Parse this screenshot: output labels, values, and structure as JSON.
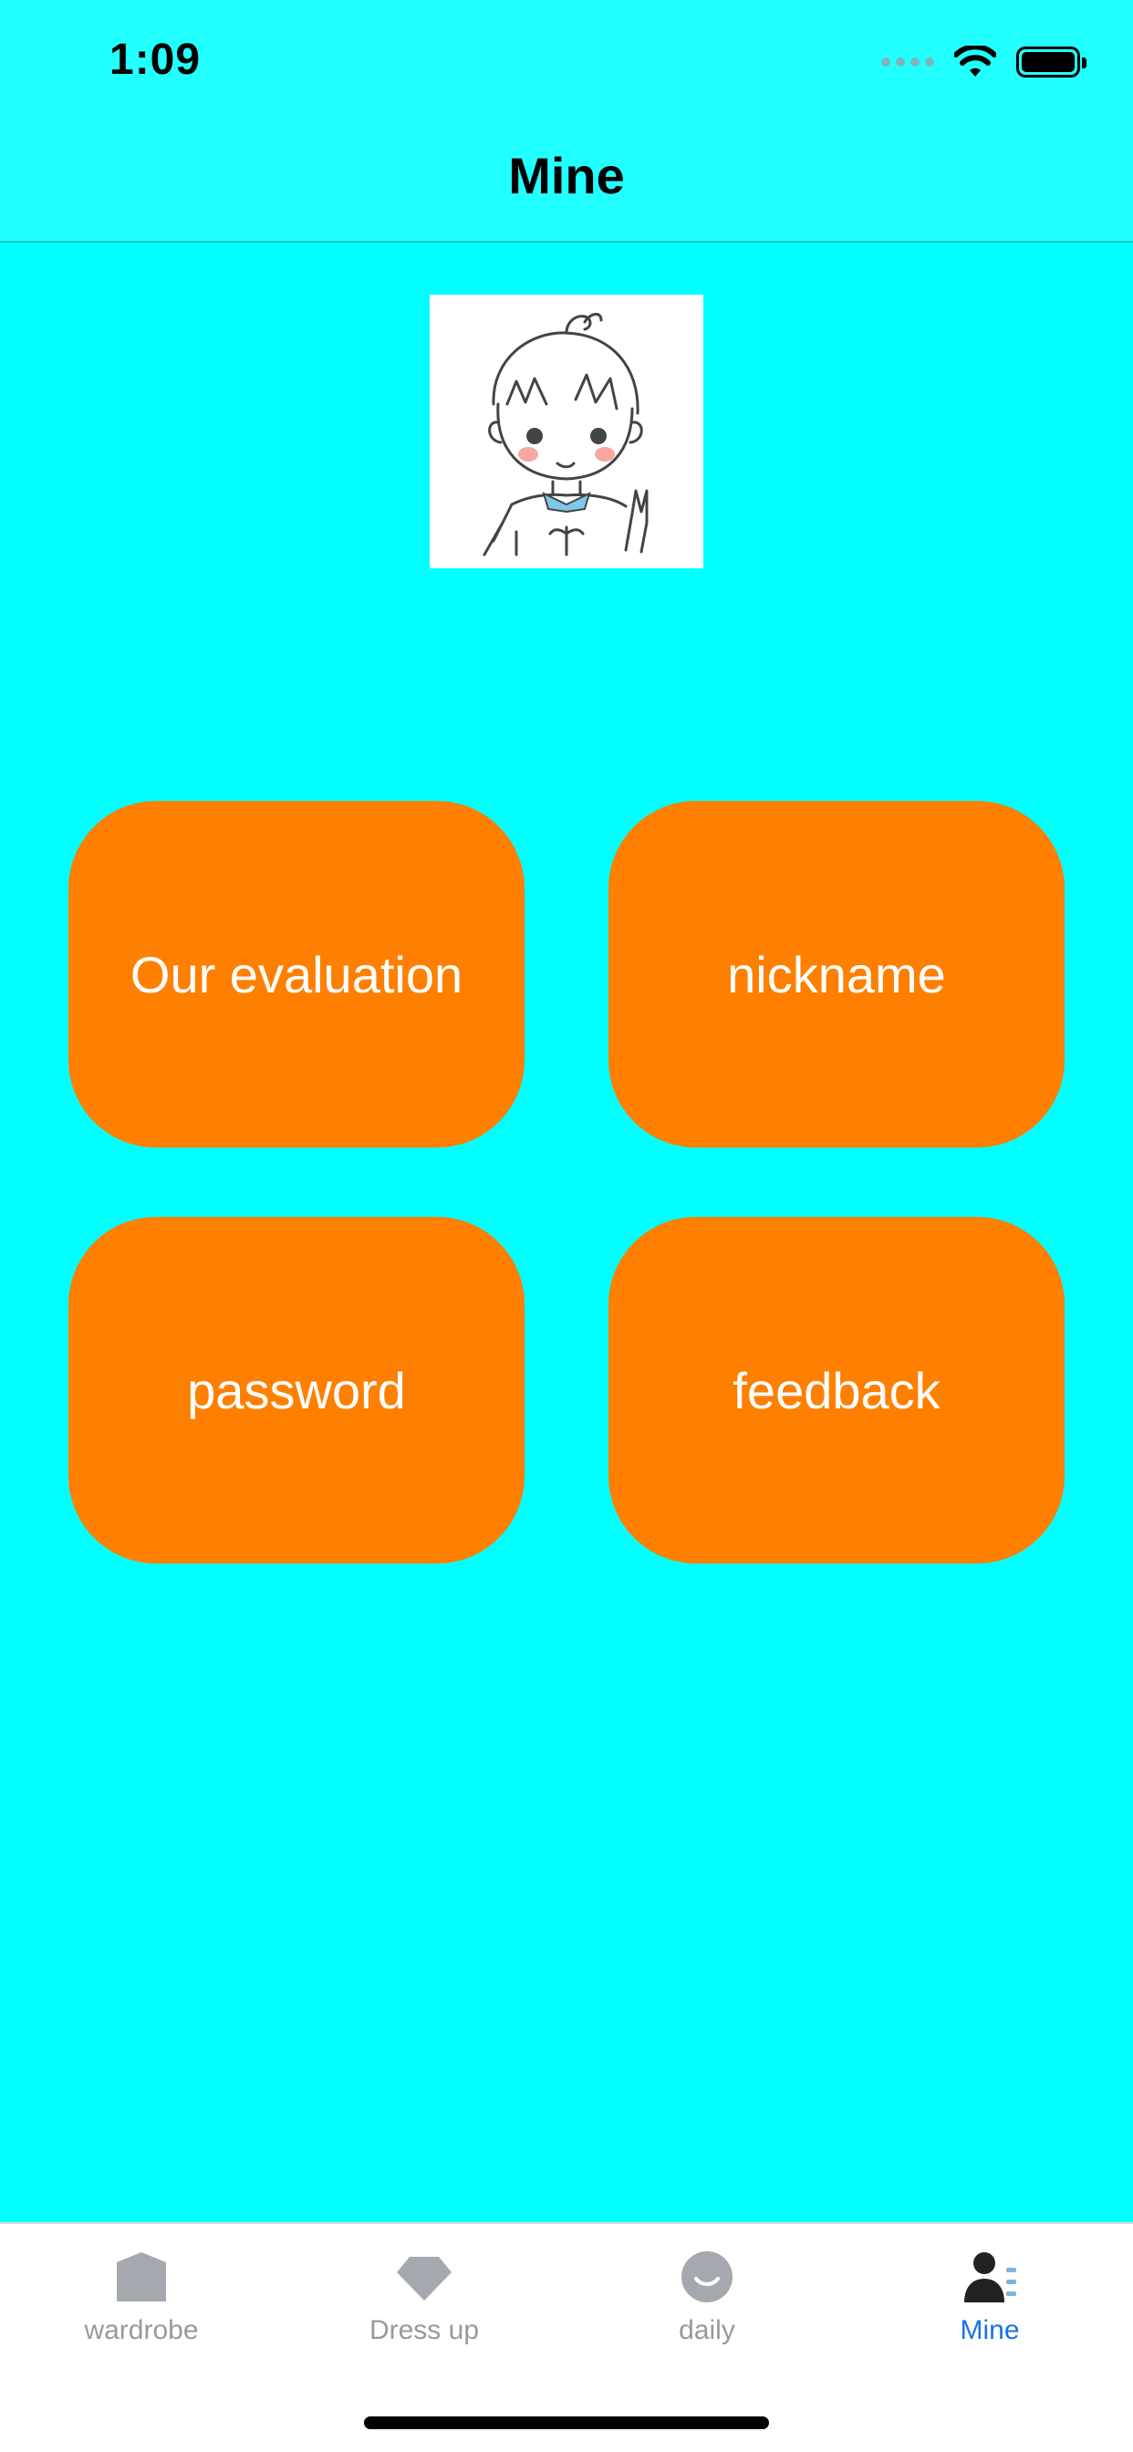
{
  "status_bar": {
    "time": "1:09",
    "icons": [
      "cellular-signal-icon",
      "wifi-icon",
      "battery-icon"
    ]
  },
  "nav": {
    "title": "Mine"
  },
  "profile": {
    "avatar_icon": "cartoon-avatar-icon"
  },
  "menu": {
    "tiles": [
      {
        "label": "Our evaluation"
      },
      {
        "label": "nickname"
      },
      {
        "label": "password"
      },
      {
        "label": "feedback"
      }
    ]
  },
  "tab_bar": {
    "items": [
      {
        "label": "wardrobe",
        "icon": "wardrobe-icon",
        "active": false
      },
      {
        "label": "Dress up",
        "icon": "diamond-icon",
        "active": false
      },
      {
        "label": "daily",
        "icon": "smile-icon",
        "active": false
      },
      {
        "label": "Mine",
        "icon": "person-icon",
        "active": true
      }
    ]
  },
  "colors": {
    "background": "#00FFFF",
    "header": "#22FFFF",
    "tile": "#FF7F00",
    "tile_text": "#FFFFFF",
    "tab_inactive": "#999999",
    "tab_active": "#1A73E8"
  }
}
